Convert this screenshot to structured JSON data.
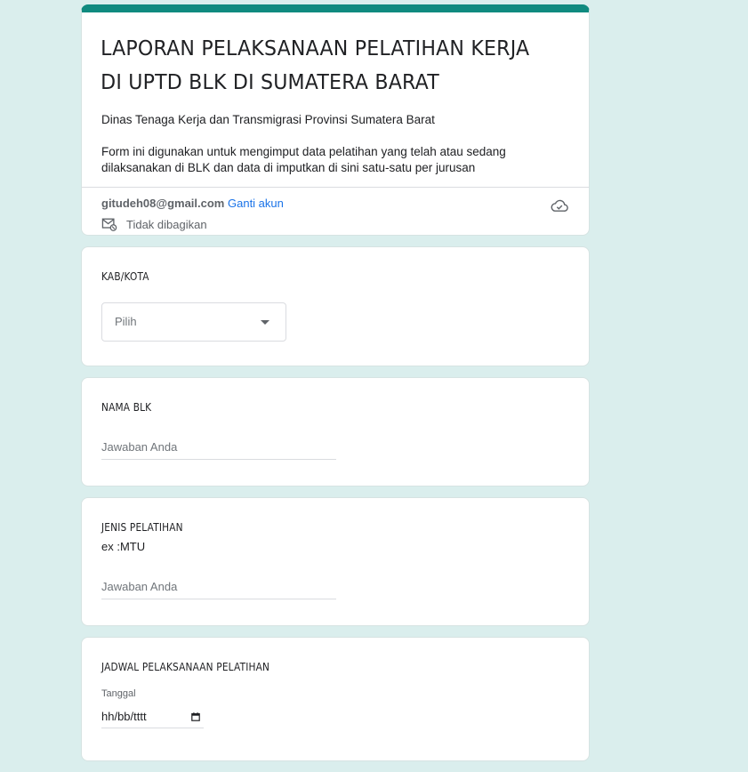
{
  "header": {
    "title": "LAPORAN PELAKSANAAN PELATIHAN KERJA DI UPTD BLK DI SUMATERA BARAT",
    "organization": "Dinas Tenaga Kerja dan Transmigrasi Provinsi Sumatera Barat",
    "description": "Form ini digunakan untuk mengimput data pelatihan yang telah atau sedang dilaksanakan di BLK dan data di imputkan di sini satu-satu  per jurusan",
    "account_email": "gitudeh08@gmail.com",
    "switch_account_label": "Ganti akun",
    "not_shared_label": "Tidak dibagikan",
    "icons": {
      "cloud": "cloud-saved-icon",
      "mail": "mail-not-shared-icon"
    },
    "accent_color": "#0f8a7f"
  },
  "questions": [
    {
      "title": "KAB/KOTA",
      "type": "dropdown",
      "selected": "Pilih"
    },
    {
      "title": "NAMA BLK",
      "type": "text",
      "placeholder": "Jawaban Anda"
    },
    {
      "title": "JENIS PELATIHAN",
      "subtitle": "ex :MTU",
      "type": "text",
      "placeholder": "Jawaban Anda"
    },
    {
      "title": "JADWAL PELAKSANAAN PELATIHAN",
      "type": "date",
      "date_label": "Tanggal",
      "date_placeholder": "hh/bb/tttt"
    }
  ],
  "page_background": "#daeeed"
}
